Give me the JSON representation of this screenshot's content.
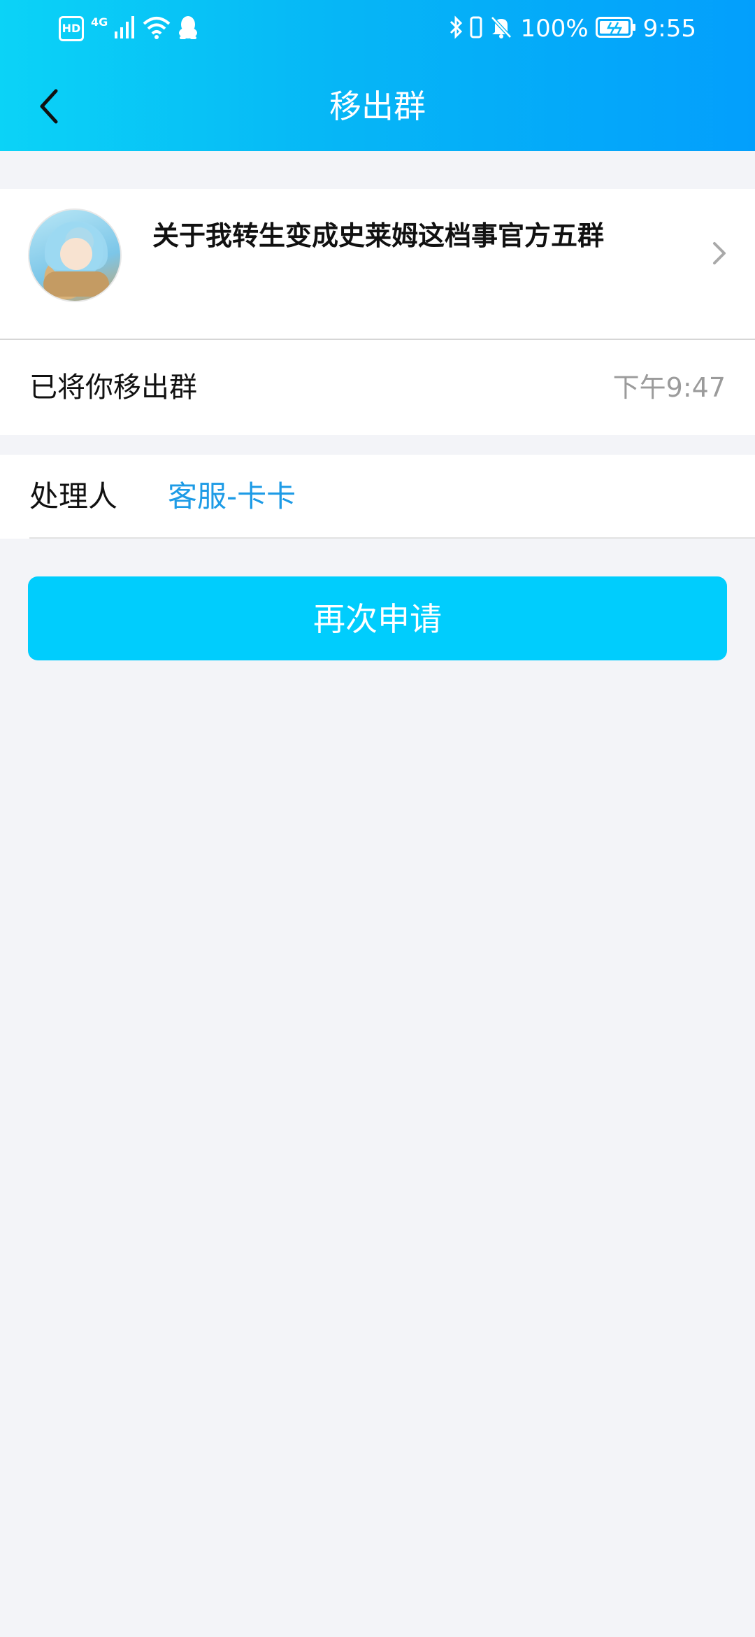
{
  "status_bar": {
    "hd_badge": "HD",
    "network": "4G",
    "battery_percent": "100%",
    "time": "9:55",
    "icons": [
      "signal-bars-icon",
      "wifi-icon",
      "qq-penguin-icon",
      "bluetooth-icon",
      "vibrate-icon",
      "mute-bell-icon",
      "battery-charging-icon"
    ]
  },
  "header": {
    "title": "移出群",
    "back_icon": "chevron-left-icon"
  },
  "group": {
    "name": "关于我转生变成史莱姆这档事官方五群",
    "chevron_icon": "chevron-right-icon"
  },
  "notice": {
    "message": "已将你移出群",
    "time": "下午9:47"
  },
  "handler": {
    "label": "处理人",
    "name": "客服-卡卡"
  },
  "actions": {
    "reapply_label": "再次申请"
  },
  "colors": {
    "header_start": "#0bd3f7",
    "header_end": "#039ffc",
    "button": "#00cdfd",
    "link": "#1d9be6",
    "background": "#f3f4f8"
  }
}
